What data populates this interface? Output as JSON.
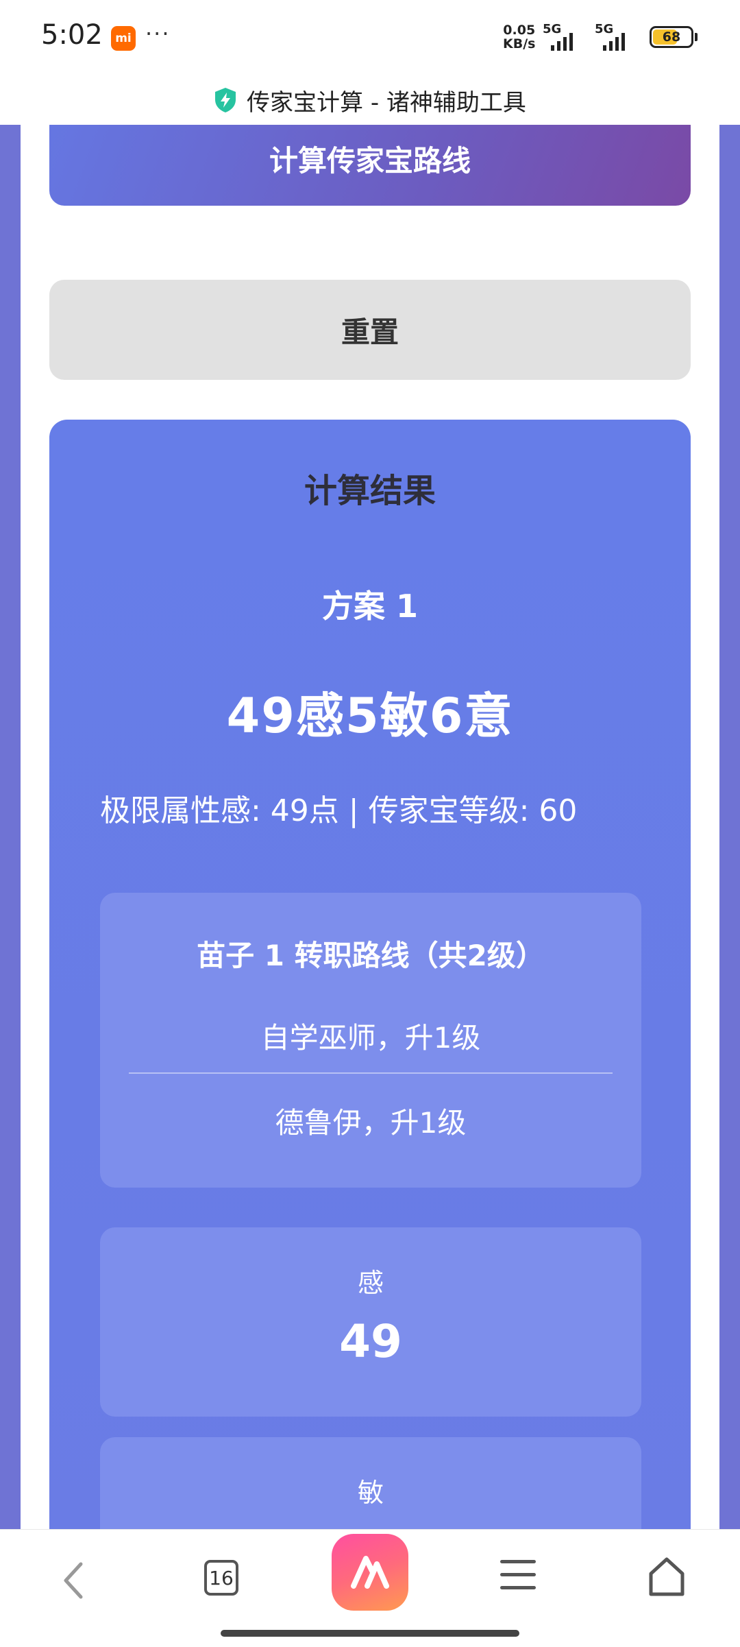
{
  "status_bar": {
    "time": "5:02",
    "app_badge": "mi",
    "more": "···",
    "net_speed_value": "0.05",
    "net_speed_unit": "KB/s",
    "signal1_label": "5G",
    "signal2_label": "5G",
    "battery": "68",
    "battery_level": 0.68
  },
  "title_bar": {
    "icon": "shield-bolt-icon",
    "title": "传家宝计算 - 诸神辅助工具"
  },
  "main": {
    "calculate_button": "计算传家宝路线",
    "reset_button": "重置",
    "result": {
      "title": "计算结果",
      "plan_title": "方案 1",
      "plan_summary": "49感5敏6意",
      "plan_detail": "极限属性感: 49点 | 传家宝等级: 60",
      "route": {
        "title": "苗子 1 转职路线（共2级）",
        "steps": [
          "自学巫师，升1级",
          "德鲁伊，升1级"
        ]
      },
      "stats": [
        {
          "label": "感",
          "value": "49"
        },
        {
          "label": "敏",
          "value": ""
        }
      ]
    }
  },
  "bottom_nav": {
    "back_icon": "chevron-left-icon",
    "tab_count": "16",
    "browser_icon": "browser-logo-icon",
    "menu_icon": "menu-icon",
    "home_icon": "home-icon"
  },
  "colors": {
    "accent": "#667de8",
    "card": "#7d8eec",
    "button_gradient_start": "#6577e2",
    "button_gradient_end": "#7a4aa6",
    "reset_bg": "#e1e1e1"
  }
}
